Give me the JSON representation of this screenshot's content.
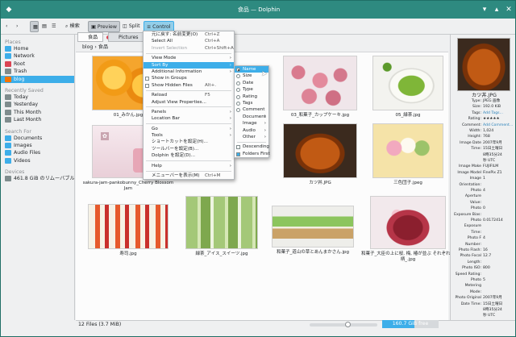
{
  "window": {
    "title": "食品 — Dolphin"
  },
  "toolbar": {
    "search": "検索",
    "preview": "Preview",
    "split": "Split",
    "control": "Control"
  },
  "places": {
    "header": "Places",
    "items": [
      {
        "label": "Home",
        "color": "#3daee9"
      },
      {
        "label": "Network",
        "color": "#3daee9"
      },
      {
        "label": "Root",
        "color": "#da4453"
      },
      {
        "label": "Trash",
        "color": "#7f8c8d"
      },
      {
        "label": "blog",
        "color": "#f67400"
      }
    ],
    "recent_header": "Recently Saved",
    "recent": [
      {
        "label": "Today"
      },
      {
        "label": "Yesterday"
      },
      {
        "label": "This Month"
      },
      {
        "label": "Last Month"
      }
    ],
    "search_header": "Search For",
    "search": [
      {
        "label": "Documents"
      },
      {
        "label": "Images"
      },
      {
        "label": "Audio Files"
      },
      {
        "label": "Videos"
      }
    ],
    "devices_header": "Devices",
    "devices": [
      {
        "label": "461.8 GiB のリムーバブルメディ..."
      }
    ]
  },
  "tabs": [
    {
      "label": "食品"
    },
    {
      "label": "Pictures"
    }
  ],
  "breadcrumb": {
    "parent": "blog",
    "current": "食品"
  },
  "files": [
    {
      "name": "01_みかん.jpg"
    },
    {
      "name": ""
    },
    {
      "name": "03_和菓子_カップケーキ.jpg"
    },
    {
      "name": "05_緑茶.jpg"
    },
    {
      "name": "sakura-jam-pankobunny_Cherry Blossom Jam"
    },
    {
      "name": ""
    },
    {
      "name": "カツ丼.JPG"
    },
    {
      "name": "三色団子.jpeg"
    },
    {
      "name": "寿司.jpg"
    },
    {
      "name": "緑茶_アイス_スイーツ.jpg"
    },
    {
      "name": "和菓子_道山の草とあんまかさん.jpg"
    },
    {
      "name": "和菓子_大臣の上に桜, 梅, 椿が並ぶ それぞれの柄_.jpg"
    }
  ],
  "status": {
    "count": "12 Files (3.7 MiB)",
    "free": "160.7 GiB free"
  },
  "info": {
    "filename": "カツ丼.JPG",
    "rows": [
      {
        "k": "Type:",
        "v": "JPEG 画像"
      },
      {
        "k": "Size:",
        "v": "192.0 KiB"
      },
      {
        "k": "Tags:",
        "v": "Add Tags..."
      },
      {
        "k": "Rating:",
        "v": "★★★★★"
      },
      {
        "k": "Comment:",
        "v": "Add Comment..."
      },
      {
        "k": "Width:",
        "v": "1,024"
      },
      {
        "k": "Height:",
        "v": "768"
      },
      {
        "k": "Image Date",
        "v": "2007年9月"
      },
      {
        "k": "Time:",
        "v": "15日土曜日"
      },
      {
        "k": "",
        "v": "8時35分24"
      },
      {
        "k": "",
        "v": "秒 UTC"
      },
      {
        "k": "Image Make",
        "v": "FUJIFILM"
      },
      {
        "k": "Image Model",
        "v": "FinePix Z1"
      },
      {
        "k": "Image",
        "v": "1"
      },
      {
        "k": "Orientation:",
        "v": ""
      },
      {
        "k": "Photo",
        "v": "4"
      },
      {
        "k": "Aperture",
        "v": ""
      },
      {
        "k": "Value:",
        "v": ""
      },
      {
        "k": "Photo",
        "v": "0"
      },
      {
        "k": "Exposure Bias:",
        "v": ""
      },
      {
        "k": "Photo",
        "v": "0.0172414"
      },
      {
        "k": "Exposure",
        "v": ""
      },
      {
        "k": "Time:",
        "v": ""
      },
      {
        "k": "Photo F",
        "v": "4"
      },
      {
        "k": "Number:",
        "v": ""
      },
      {
        "k": "Photo Flash:",
        "v": "16"
      },
      {
        "k": "Photo Focal",
        "v": "12.7"
      },
      {
        "k": "Length:",
        "v": ""
      },
      {
        "k": "Photo ISO:",
        "v": "800"
      },
      {
        "k": "Speed Rating:",
        "v": ""
      },
      {
        "k": "Photo",
        "v": "5"
      },
      {
        "k": "Metering",
        "v": ""
      },
      {
        "k": "Mode:",
        "v": ""
      },
      {
        "k": "Photo Original",
        "v": "2007年9月"
      },
      {
        "k": "Date Time:",
        "v": "15日土曜日"
      },
      {
        "k": "",
        "v": "8時35分24"
      },
      {
        "k": "",
        "v": "秒 UTC"
      }
    ]
  },
  "control_menu": [
    {
      "label": "元に戻す: 名前変更(O)",
      "sc": "Ctrl+Z",
      "type": "item"
    },
    {
      "label": "Select All",
      "sc": "Ctrl+A",
      "type": "item"
    },
    {
      "label": "Invert Selection",
      "sc": "Ctrl+Shift+A",
      "type": "dis"
    },
    {
      "type": "sep"
    },
    {
      "label": "View Mode",
      "sc": "",
      "type": "sub"
    },
    {
      "label": "Sort By",
      "sc": "",
      "type": "subhl"
    },
    {
      "label": "Additional Information",
      "sc": "",
      "type": "sub"
    },
    {
      "label": "Show in Groups",
      "sc": "",
      "type": "chk"
    },
    {
      "label": "Show Hidden Files",
      "sc": "Alt+.",
      "type": "chk"
    },
    {
      "type": "sep"
    },
    {
      "label": "Reload",
      "sc": "F5",
      "type": "item"
    },
    {
      "label": "Adjust View Properties...",
      "sc": "",
      "type": "item"
    },
    {
      "type": "sep"
    },
    {
      "label": "Panels",
      "sc": "",
      "type": "sub"
    },
    {
      "label": "Location Bar",
      "sc": "",
      "type": "sub"
    },
    {
      "type": "sep"
    },
    {
      "label": "Go",
      "sc": "",
      "type": "sub"
    },
    {
      "label": "Tools",
      "sc": "",
      "type": "sub"
    },
    {
      "label": "ショートカットを設定(H)...",
      "sc": "",
      "type": "item"
    },
    {
      "label": "ツールバーを設定(B)...",
      "sc": "",
      "type": "item"
    },
    {
      "label": "Dolphin を設定(D)...",
      "sc": "",
      "type": "item"
    },
    {
      "type": "sep"
    },
    {
      "label": "Help",
      "sc": "",
      "type": "sub"
    },
    {
      "type": "sep"
    },
    {
      "label": "メニューバーを表示(M)",
      "sc": "Ctrl+M",
      "type": "item"
    }
  ],
  "sort_menu": [
    {
      "label": "Name",
      "type": "radon"
    },
    {
      "label": "Size",
      "type": "rad"
    },
    {
      "label": "Date",
      "type": "rad"
    },
    {
      "label": "Type",
      "type": "rad"
    },
    {
      "label": "Rating",
      "type": "rad"
    },
    {
      "label": "Tags",
      "type": "rad"
    },
    {
      "label": "Comment",
      "type": "rad"
    },
    {
      "label": "Document",
      "type": "sub"
    },
    {
      "label": "Image",
      "type": "sub"
    },
    {
      "label": "Audio",
      "type": "sub"
    },
    {
      "label": "Other",
      "type": "sub"
    },
    {
      "type": "sep"
    },
    {
      "label": "Descending",
      "type": "chk"
    },
    {
      "label": "Folders First",
      "type": "chkon"
    }
  ],
  "colors": {
    "accent": "#3daee9",
    "title_bar": "#2e8a80"
  }
}
